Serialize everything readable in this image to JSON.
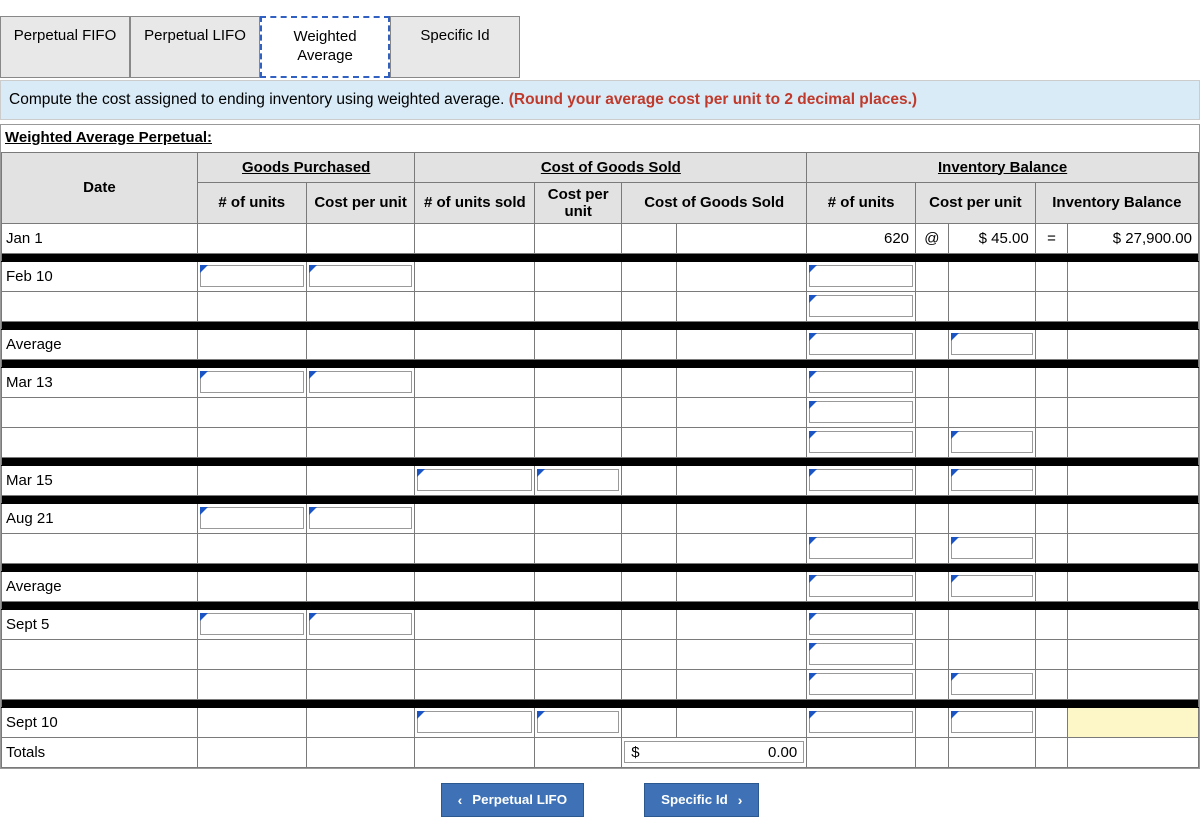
{
  "tabs": {
    "t0": "Perpetual FIFO",
    "t1": "Perpetual LIFO",
    "t2": "Weighted\nAverage",
    "t3": "Specific Id"
  },
  "instruction": {
    "plain": "Compute the cost assigned to ending inventory using weighted average. ",
    "emph": "(Round your average cost per unit to 2 decimal places.)"
  },
  "section_title": "Weighted Average Perpetual:",
  "headers": {
    "date": "Date",
    "goods_purchased": "Goods Purchased",
    "cogs": "Cost of Goods Sold",
    "inv_bal": "Inventory Balance",
    "gp_units": "# of units",
    "gp_cost": "Cost per unit",
    "cs_units": "# of units sold",
    "cs_cost": "Cost per unit",
    "cs_total": "Cost of Goods Sold",
    "ib_units": "# of units",
    "ib_cost": "Cost per unit",
    "ib_total": "Inventory Balance"
  },
  "rows": {
    "r0": "Jan 1",
    "r1": "Feb 10",
    "r2": "Average",
    "r3": "Mar 13",
    "r4": "Mar 15",
    "r5": "Aug 21",
    "r6": "Average",
    "r7": "Sept 5",
    "r8": "Sept 10",
    "r9": "Totals"
  },
  "jan1": {
    "units": "620",
    "at": "@",
    "cost": "$ 45.00",
    "eq": "=",
    "balance": "$ 27,900.00"
  },
  "totals": {
    "currency": "$",
    "cogs": "0.00"
  },
  "nav": {
    "prev": "Perpetual LIFO",
    "next": "Specific Id"
  }
}
